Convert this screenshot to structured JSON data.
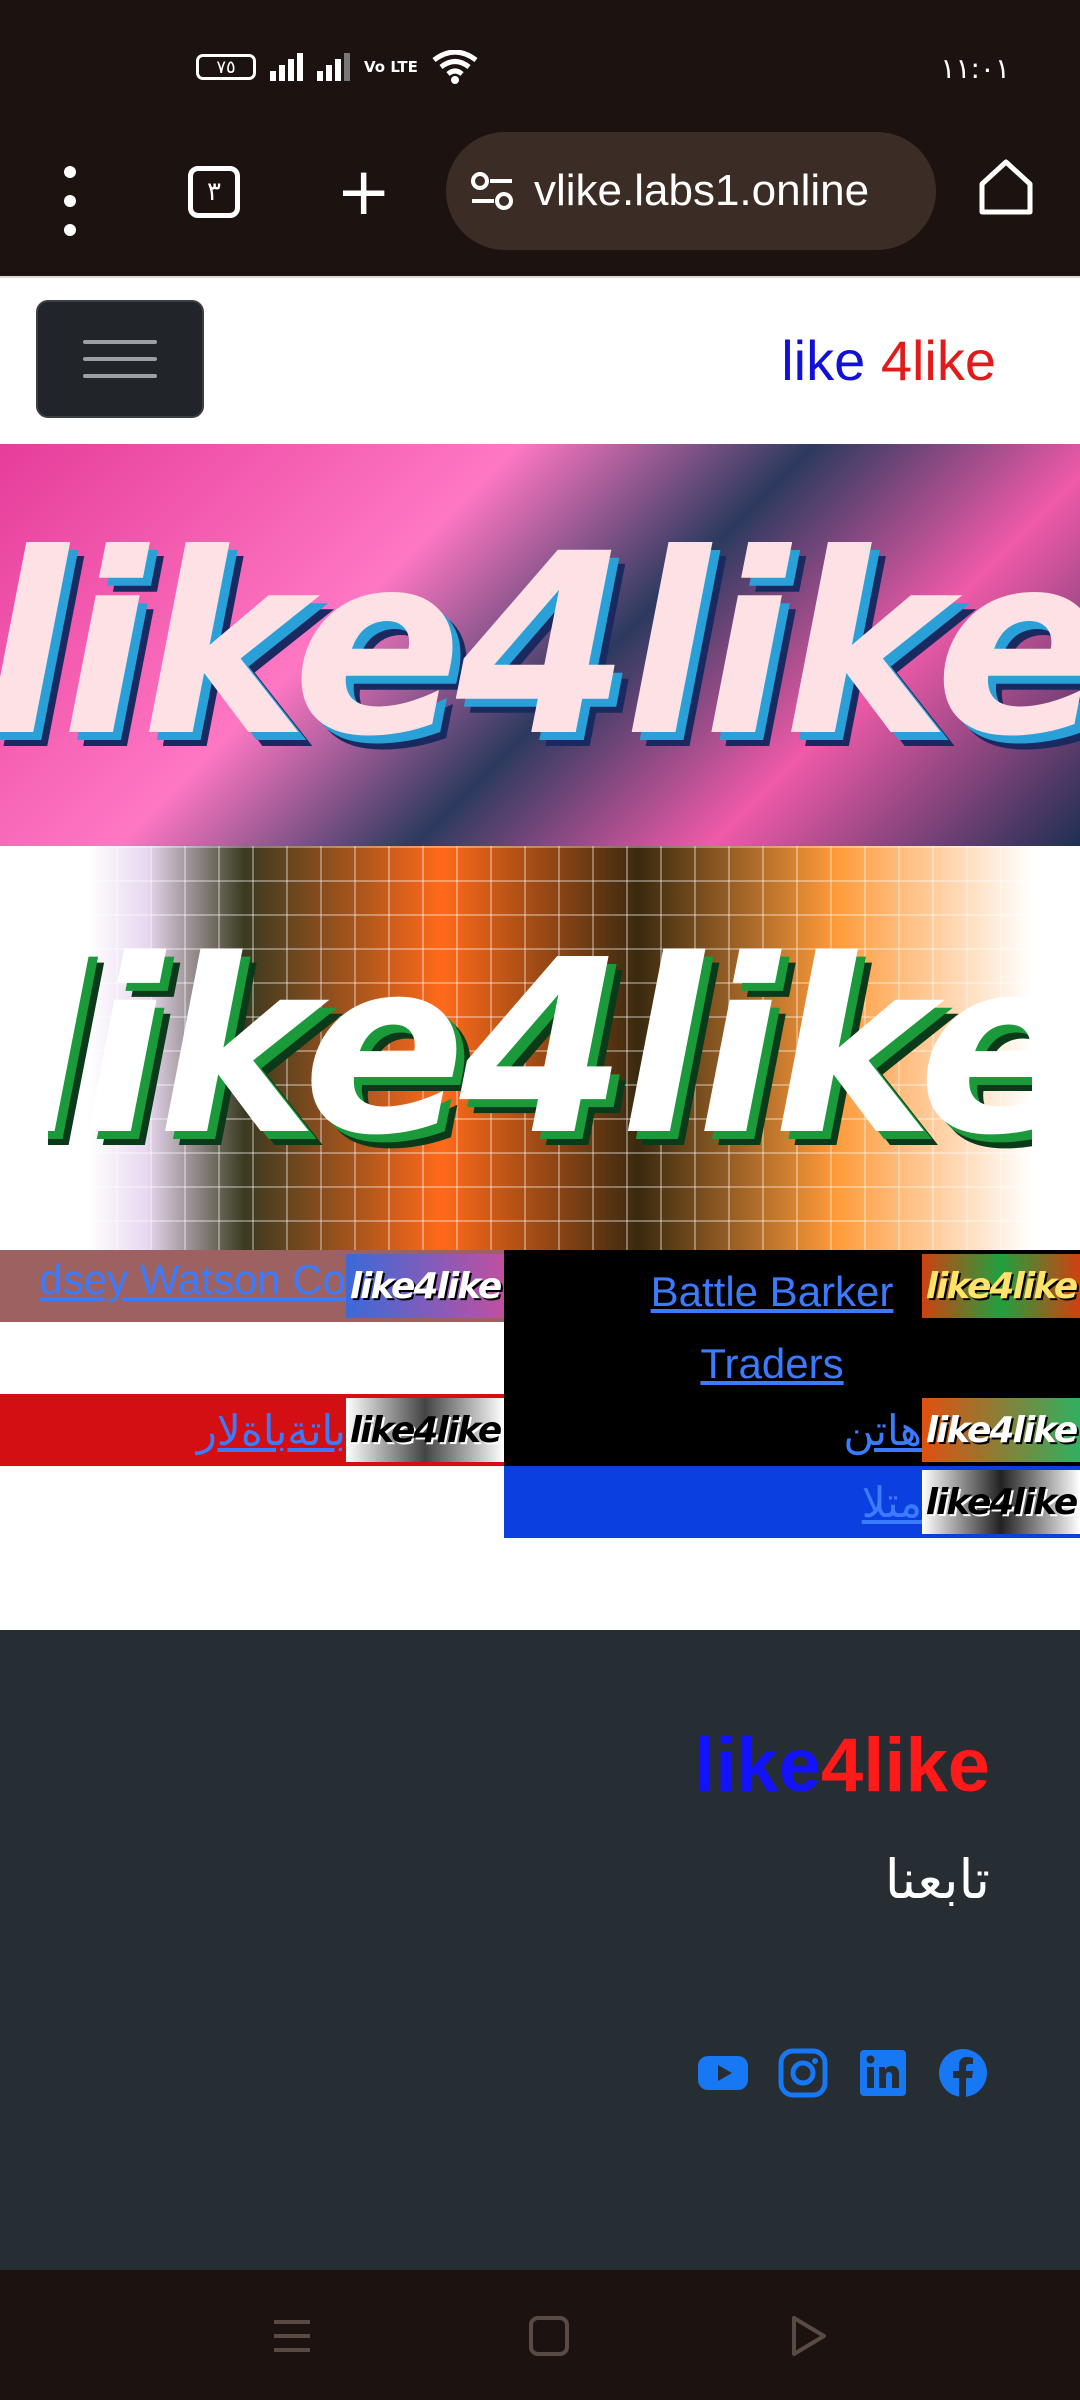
{
  "status_bar": {
    "battery": "٧٥",
    "network": "Vo LTE",
    "time": "١١:٠١"
  },
  "browser": {
    "tab_count": "٣",
    "url": "vlike.labs1.online"
  },
  "navbar": {
    "brand_part1": "like",
    "brand_part2": "4like"
  },
  "banners": {
    "banner1_text": "like4like",
    "banner2_text": "like4like"
  },
  "links": [
    {
      "label": "dsey Watson Co",
      "thumb": "like4like"
    },
    {
      "label": "Battle Barker Traders",
      "thumb": "like4like"
    },
    {
      "label": "باتةباةلار",
      "thumb": "like4like"
    },
    {
      "label": "هاتن",
      "thumb": "like4like"
    },
    {
      "label": "متلا",
      "thumb": "like4like"
    }
  ],
  "footer": {
    "brand_part1": "like",
    "brand_part2": "4like",
    "follow_label": "تابعنا",
    "socials": [
      "youtube-icon",
      "instagram-icon",
      "linkedin-icon",
      "facebook-icon"
    ]
  },
  "colors": {
    "link": "#3a7bff",
    "brand_blue": "#1010d8",
    "brand_red": "#e11a1a",
    "footer_bg": "#262d33"
  }
}
